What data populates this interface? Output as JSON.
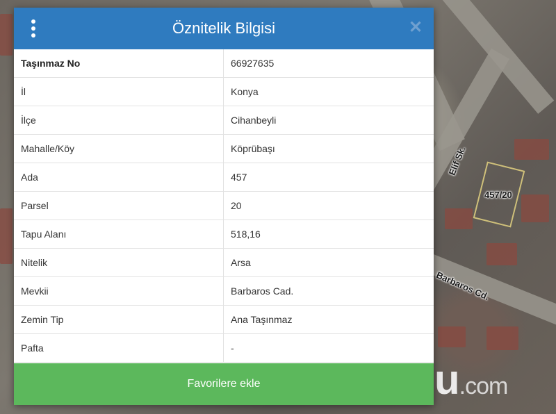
{
  "dialog": {
    "title": "Öznitelik Bilgisi",
    "rows": [
      {
        "key": "Taşınmaz No",
        "value": "66927635"
      },
      {
        "key": "İl",
        "value": "Konya"
      },
      {
        "key": "İlçe",
        "value": "Cihanbeyli"
      },
      {
        "key": "Mahalle/Köy",
        "value": "Köprübaşı"
      },
      {
        "key": "Ada",
        "value": "457"
      },
      {
        "key": "Parsel",
        "value": "20"
      },
      {
        "key": "Tapu Alanı",
        "value": "518,16"
      },
      {
        "key": "Nitelik",
        "value": "Arsa"
      },
      {
        "key": "Mevkii",
        "value": "Barbaros Cad."
      },
      {
        "key": "Zemin Tip",
        "value": "Ana Taşınmaz"
      },
      {
        "key": "Pafta",
        "value": "-"
      }
    ],
    "favorite_label": "Favorilere ekle",
    "menu_icon": "more-vertical-icon",
    "close_icon": "close-icon"
  },
  "map": {
    "parcel_label": "457/20",
    "street_labels": [
      "Elif Sk.",
      "Barbaros Cd."
    ]
  },
  "watermark": {
    "brand": "tapu",
    "domain": ".com"
  },
  "colors": {
    "header": "#2f7bbf",
    "favorite_button": "#5cb85c"
  }
}
